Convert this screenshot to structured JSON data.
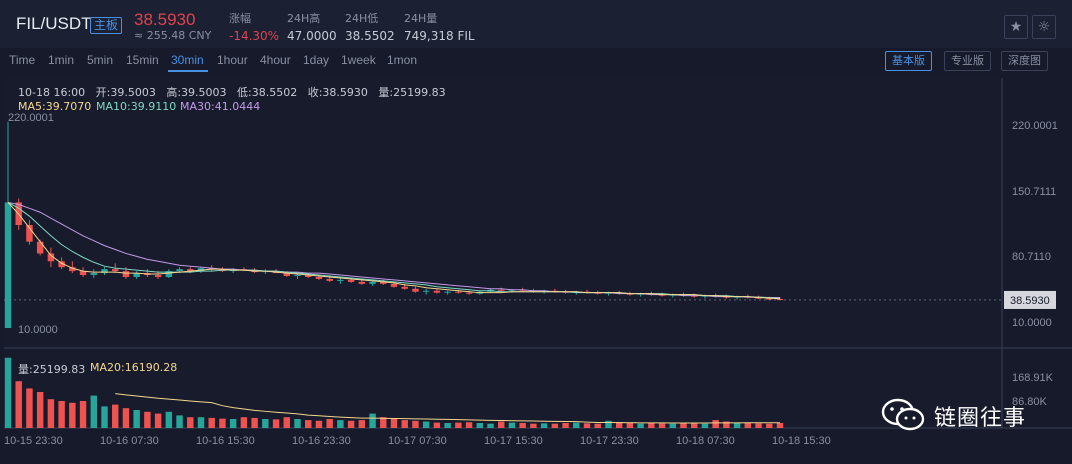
{
  "header": {
    "pair": "FIL/USDT",
    "tag": "主板",
    "price": "38.5930",
    "cny": "≈ 255.48 CNY",
    "stats": [
      {
        "label": "涨幅",
        "value": "-14.30%"
      },
      {
        "label": "24H高",
        "value": "47.0000"
      },
      {
        "label": "24H低",
        "value": "38.5502"
      },
      {
        "label": "24H量",
        "value": "749,318 FIL"
      }
    ],
    "star_icon": "star-icon",
    "theme_icon": "sun-icon"
  },
  "toolbar": {
    "timeframes": [
      "Time",
      "1min",
      "5min",
      "15min",
      "30min",
      "1hour",
      "4hour",
      "1day",
      "1week",
      "1mon"
    ],
    "active": "30min",
    "views": [
      "基本版",
      "专业版",
      "深度图"
    ],
    "active_view": "基本版"
  },
  "info": {
    "ohlc": "10-18 16:00   开:39.5003   高:39.5003   低:38.5502   收:38.5930   量:25199.83",
    "ma5": "MA5:39.7070",
    "ma10": "MA10:39.9110",
    "ma30": "MA30:41.0444"
  },
  "volume_legend": {
    "vol": "量:25199.83",
    "ma20": "MA20:16190.28"
  },
  "watermark": {
    "text": "链圈往事"
  },
  "colors": {
    "up": "#26a69a",
    "down": "#ef5350",
    "ma5": "#f5d78c",
    "ma10": "#7fd8c4",
    "ma30": "#c39ae8",
    "ma20": "#f5d78c",
    "accent": "#4a90e2"
  },
  "chart_data": {
    "type": "candlestick",
    "y_ticks": [
      "220.0001",
      "150.7111",
      "80.7110",
      "10.0000"
    ],
    "last_price_label": "38.5930",
    "max_label": "220.0001",
    "min_label": "10.0000",
    "ylim": [
      10,
      220.0001
    ],
    "x_ticks": [
      "10-15 23:30",
      "10-16 07:30",
      "10-16 15:30",
      "10-16 23:30",
      "10-17 07:30",
      "10-17 15:30",
      "10-17 23:30",
      "10-18 07:30",
      "10-18 15:30"
    ],
    "volume_y_ticks": [
      "168.91K",
      "86.80K"
    ],
    "volume_ylim": [
      0,
      200
    ],
    "candles": [
      [
        10,
        220,
        10,
        138
      ],
      [
        138,
        142,
        110,
        115
      ],
      [
        115,
        120,
        95,
        98
      ],
      [
        98,
        100,
        84,
        86
      ],
      [
        86,
        92,
        72,
        78
      ],
      [
        78,
        82,
        70,
        72
      ],
      [
        72,
        78,
        66,
        68
      ],
      [
        68,
        72,
        62,
        64
      ],
      [
        64,
        70,
        61,
        66
      ],
      [
        66,
        72,
        64,
        70
      ],
      [
        70,
        76,
        66,
        68
      ],
      [
        68,
        72,
        60,
        62
      ],
      [
        62,
        68,
        60,
        66
      ],
      [
        66,
        70,
        62,
        64
      ],
      [
        64,
        68,
        60,
        62
      ],
      [
        62,
        70,
        61,
        68
      ],
      [
        68,
        72,
        66,
        70
      ],
      [
        70,
        72,
        66,
        68
      ],
      [
        68,
        72,
        66,
        71
      ],
      [
        71,
        74,
        68,
        70
      ],
      [
        70,
        72,
        67,
        68
      ],
      [
        68,
        71,
        66,
        70
      ],
      [
        70,
        72,
        68,
        69
      ],
      [
        69,
        71,
        66,
        67
      ],
      [
        67,
        70,
        65,
        68
      ],
      [
        68,
        70,
        66,
        66
      ],
      [
        66,
        68,
        62,
        63
      ],
      [
        63,
        66,
        60,
        64
      ],
      [
        64,
        66,
        61,
        62
      ],
      [
        62,
        64,
        59,
        60
      ],
      [
        60,
        63,
        57,
        58
      ],
      [
        58,
        61,
        55,
        59
      ],
      [
        59,
        61,
        56,
        57
      ],
      [
        57,
        59,
        54,
        55
      ],
      [
        55,
        58,
        53,
        57
      ],
      [
        57,
        59,
        54,
        55
      ],
      [
        55,
        57,
        51,
        52
      ],
      [
        52,
        55,
        49,
        50
      ],
      [
        50,
        52,
        46,
        47
      ],
      [
        47,
        50,
        44,
        48
      ],
      [
        48,
        50,
        45,
        46
      ],
      [
        46,
        48,
        44,
        47
      ],
      [
        47,
        49,
        45,
        46
      ],
      [
        46,
        48,
        44,
        45
      ],
      [
        45,
        48,
        44,
        47
      ],
      [
        47,
        50,
        46,
        49
      ],
      [
        49,
        51,
        47,
        48
      ],
      [
        48,
        50,
        46,
        49
      ],
      [
        49,
        51,
        47,
        48
      ],
      [
        48,
        50,
        46,
        47
      ],
      [
        47,
        49,
        45,
        48
      ],
      [
        48,
        50,
        46,
        47
      ],
      [
        47,
        49,
        45,
        46
      ],
      [
        46,
        48,
        44,
        47
      ],
      [
        47,
        49,
        45,
        46
      ],
      [
        46,
        48,
        44,
        45
      ],
      [
        45,
        47,
        43,
        46
      ],
      [
        46,
        48,
        44,
        45
      ],
      [
        45,
        47,
        43,
        44
      ],
      [
        44,
        46,
        42,
        45
      ],
      [
        45,
        47,
        43,
        44
      ],
      [
        44,
        46,
        42,
        43
      ],
      [
        43,
        45,
        41,
        44
      ],
      [
        44,
        46,
        42,
        43
      ],
      [
        43,
        45,
        41,
        42
      ],
      [
        42,
        44,
        40,
        43
      ],
      [
        43,
        45,
        41,
        42
      ],
      [
        42,
        44,
        40,
        41
      ],
      [
        41,
        43,
        39,
        42
      ],
      [
        42,
        44,
        40,
        41
      ],
      [
        41,
        43,
        39.5,
        40
      ],
      [
        40,
        42,
        38.5,
        39.5
      ],
      [
        39.5,
        41,
        38.5,
        38.59
      ]
    ],
    "volumes": [
      195,
      130,
      110,
      100,
      80,
      75,
      70,
      75,
      90,
      60,
      65,
      55,
      50,
      45,
      40,
      45,
      35,
      30,
      30,
      28,
      26,
      25,
      30,
      28,
      25,
      24,
      30,
      25,
      22,
      20,
      25,
      22,
      20,
      22,
      40,
      30,
      25,
      22,
      20,
      18,
      15,
      14,
      15,
      16,
      14,
      12,
      18,
      15,
      14,
      12,
      13,
      12,
      14,
      15,
      13,
      12,
      20,
      16,
      14,
      12,
      14,
      13,
      12,
      15,
      14,
      12,
      22,
      18,
      15,
      14,
      13,
      12,
      14
    ],
    "ma5": [
      138,
      126,
      112,
      98,
      84,
      76,
      71,
      68,
      67,
      67,
      67,
      66,
      66,
      65,
      65,
      66,
      67,
      68,
      69,
      70,
      70,
      69,
      69,
      68,
      68,
      67,
      66,
      65,
      64,
      63,
      62,
      61,
      60,
      59,
      58,
      57,
      56,
      54,
      53,
      51,
      50,
      49,
      48,
      47,
      46,
      46,
      46,
      47,
      47,
      47,
      47,
      47,
      47,
      47,
      46,
      46,
      46,
      46,
      45,
      45,
      45,
      44,
      44,
      44,
      44,
      43,
      43,
      42,
      42,
      42,
      41,
      40.5,
      39.7
    ],
    "ma10": [
      138,
      132,
      124,
      114,
      104,
      95,
      88,
      82,
      77,
      73,
      71,
      70,
      69,
      68,
      67,
      67,
      67,
      67,
      68,
      68,
      69,
      69,
      69,
      69,
      68,
      68,
      67,
      66,
      65,
      64,
      63,
      62,
      61,
      60,
      59,
      58,
      57,
      56,
      55,
      54,
      52,
      51,
      50,
      49,
      48,
      48,
      47,
      47,
      47,
      47,
      47,
      47,
      47,
      46,
      46,
      46,
      46,
      46,
      45,
      45,
      45,
      45,
      44,
      44,
      44,
      43,
      43,
      43,
      42,
      42,
      41.5,
      41,
      39.9
    ],
    "ma30": [
      138,
      136,
      132,
      128,
      122,
      116,
      110,
      104,
      99,
      94,
      90,
      86,
      83,
      80,
      78,
      76,
      74,
      73,
      72,
      71,
      70,
      70,
      69,
      69,
      68,
      68,
      67,
      67,
      66,
      66,
      65,
      64,
      63,
      62,
      61,
      60,
      59,
      58,
      57,
      56,
      55,
      54,
      53,
      52,
      51,
      50,
      50,
      49,
      49,
      48,
      48,
      47,
      47,
      47,
      46,
      46,
      46,
      45,
      45,
      45,
      44,
      44,
      44,
      43,
      43,
      43,
      42,
      42,
      42,
      41.5,
      41.3,
      41.1,
      41.04
    ]
  }
}
